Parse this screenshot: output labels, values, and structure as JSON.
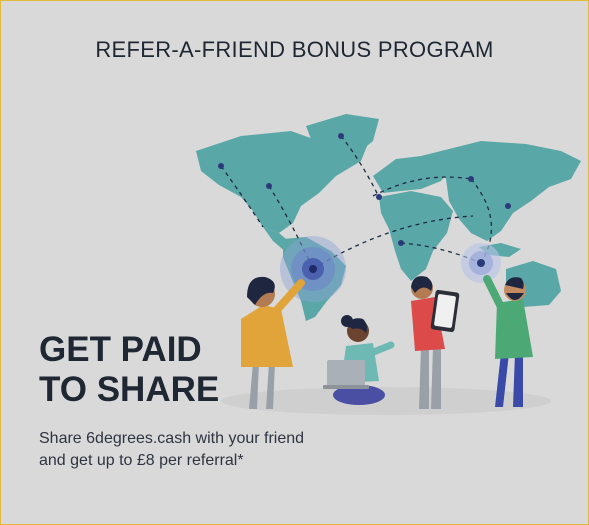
{
  "promo": {
    "title": "REFER-A-FRIEND BONUS PROGRAM",
    "headline_line1": "GET PAID",
    "headline_line2": "TO SHARE",
    "description": "Share 6degrees.cash with your friend and get up to £8 per referral*"
  },
  "colors": {
    "background": "#d9d9d9",
    "border": "#e3b93a",
    "map": "#5aa7a7",
    "text": "#1f2733"
  },
  "icons": [
    "world-map-illustration",
    "location-pin-icon"
  ]
}
